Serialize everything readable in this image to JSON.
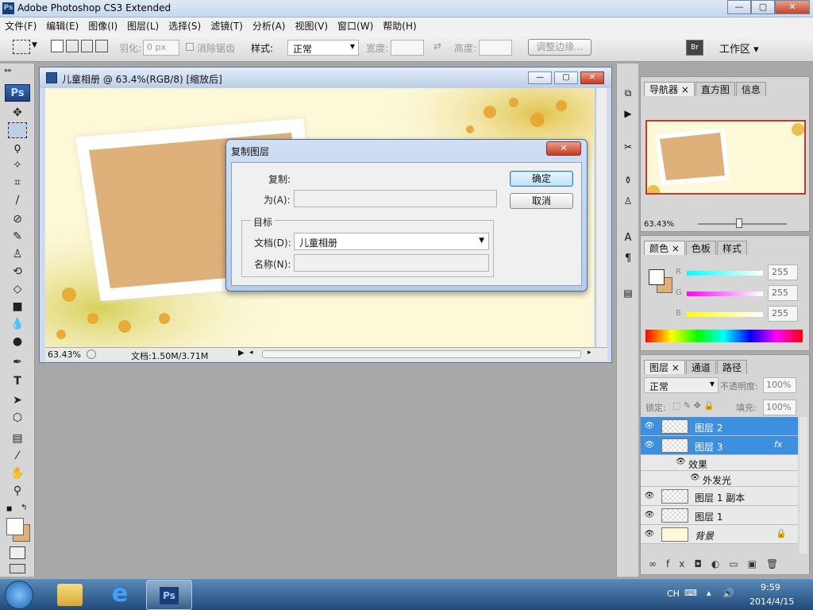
{
  "app": {
    "title": "Adobe Photoshop CS3 Extended",
    "logo": "Ps"
  },
  "window_controls": {
    "minimize": "—",
    "maximize": "▢",
    "close": "✕"
  },
  "menu": [
    "文件(F)",
    "编辑(E)",
    "图像(I)",
    "图层(L)",
    "选择(S)",
    "滤镜(T)",
    "分析(A)",
    "视图(V)",
    "窗口(W)",
    "帮助(H)"
  ],
  "options": {
    "feather_label": "羽化:",
    "feather_value": "0 px",
    "antialias_label": "消除锯齿",
    "style_label": "样式:",
    "style_value": "正常",
    "width_label": "宽度:",
    "height_label": "高度:",
    "refine_button": "调整边缘...",
    "workspace": "工作区"
  },
  "document": {
    "title": "儿童相册 @ 63.4%(RGB/8) [缩放后]",
    "zoom": "63.43%",
    "status": "文档:1.50M/3.71M"
  },
  "dialog": {
    "title": "复制图层",
    "duplicate_label": "复制:",
    "as_label": "为(A):",
    "as_value": "",
    "target_label": "目标",
    "doc_label": "文档(D):",
    "doc_value": "儿童相册",
    "name_label": "名称(N):",
    "name_value": "",
    "ok": "确定",
    "cancel": "取消"
  },
  "navigator": {
    "tabs": [
      "导航器",
      "直方图",
      "信息"
    ],
    "zoom": "63.43%"
  },
  "color": {
    "tabs": [
      "颜色",
      "色板",
      "样式"
    ],
    "channels": [
      {
        "label": "R",
        "value": "255"
      },
      {
        "label": "G",
        "value": "255"
      },
      {
        "label": "B",
        "value": "255"
      }
    ],
    "foreground": "#ffffff",
    "background": "#e0b07a"
  },
  "layers": {
    "tabs": [
      "图层",
      "通道",
      "路径"
    ],
    "blend_mode": "正常",
    "opacity_label": "不透明度:",
    "opacity_value": "100%",
    "lock_label": "锁定:",
    "fill_label": "填充:",
    "fill_value": "100%",
    "items": [
      {
        "name": "图层 2",
        "selected": true
      },
      {
        "name": "图层 3",
        "selected": true,
        "fx": "fx"
      },
      {
        "name": "效果",
        "sub": true
      },
      {
        "name": "外发光",
        "sub": true
      },
      {
        "name": "图层 1 副本",
        "selected": false
      },
      {
        "name": "图层 1",
        "selected": false
      },
      {
        "name": "背景",
        "selected": false
      }
    ],
    "fx_label": "fx"
  },
  "taskbar": {
    "lang": "CH",
    "time": "9:59",
    "date": "2014/4/15",
    "ps_label": "Ps"
  }
}
